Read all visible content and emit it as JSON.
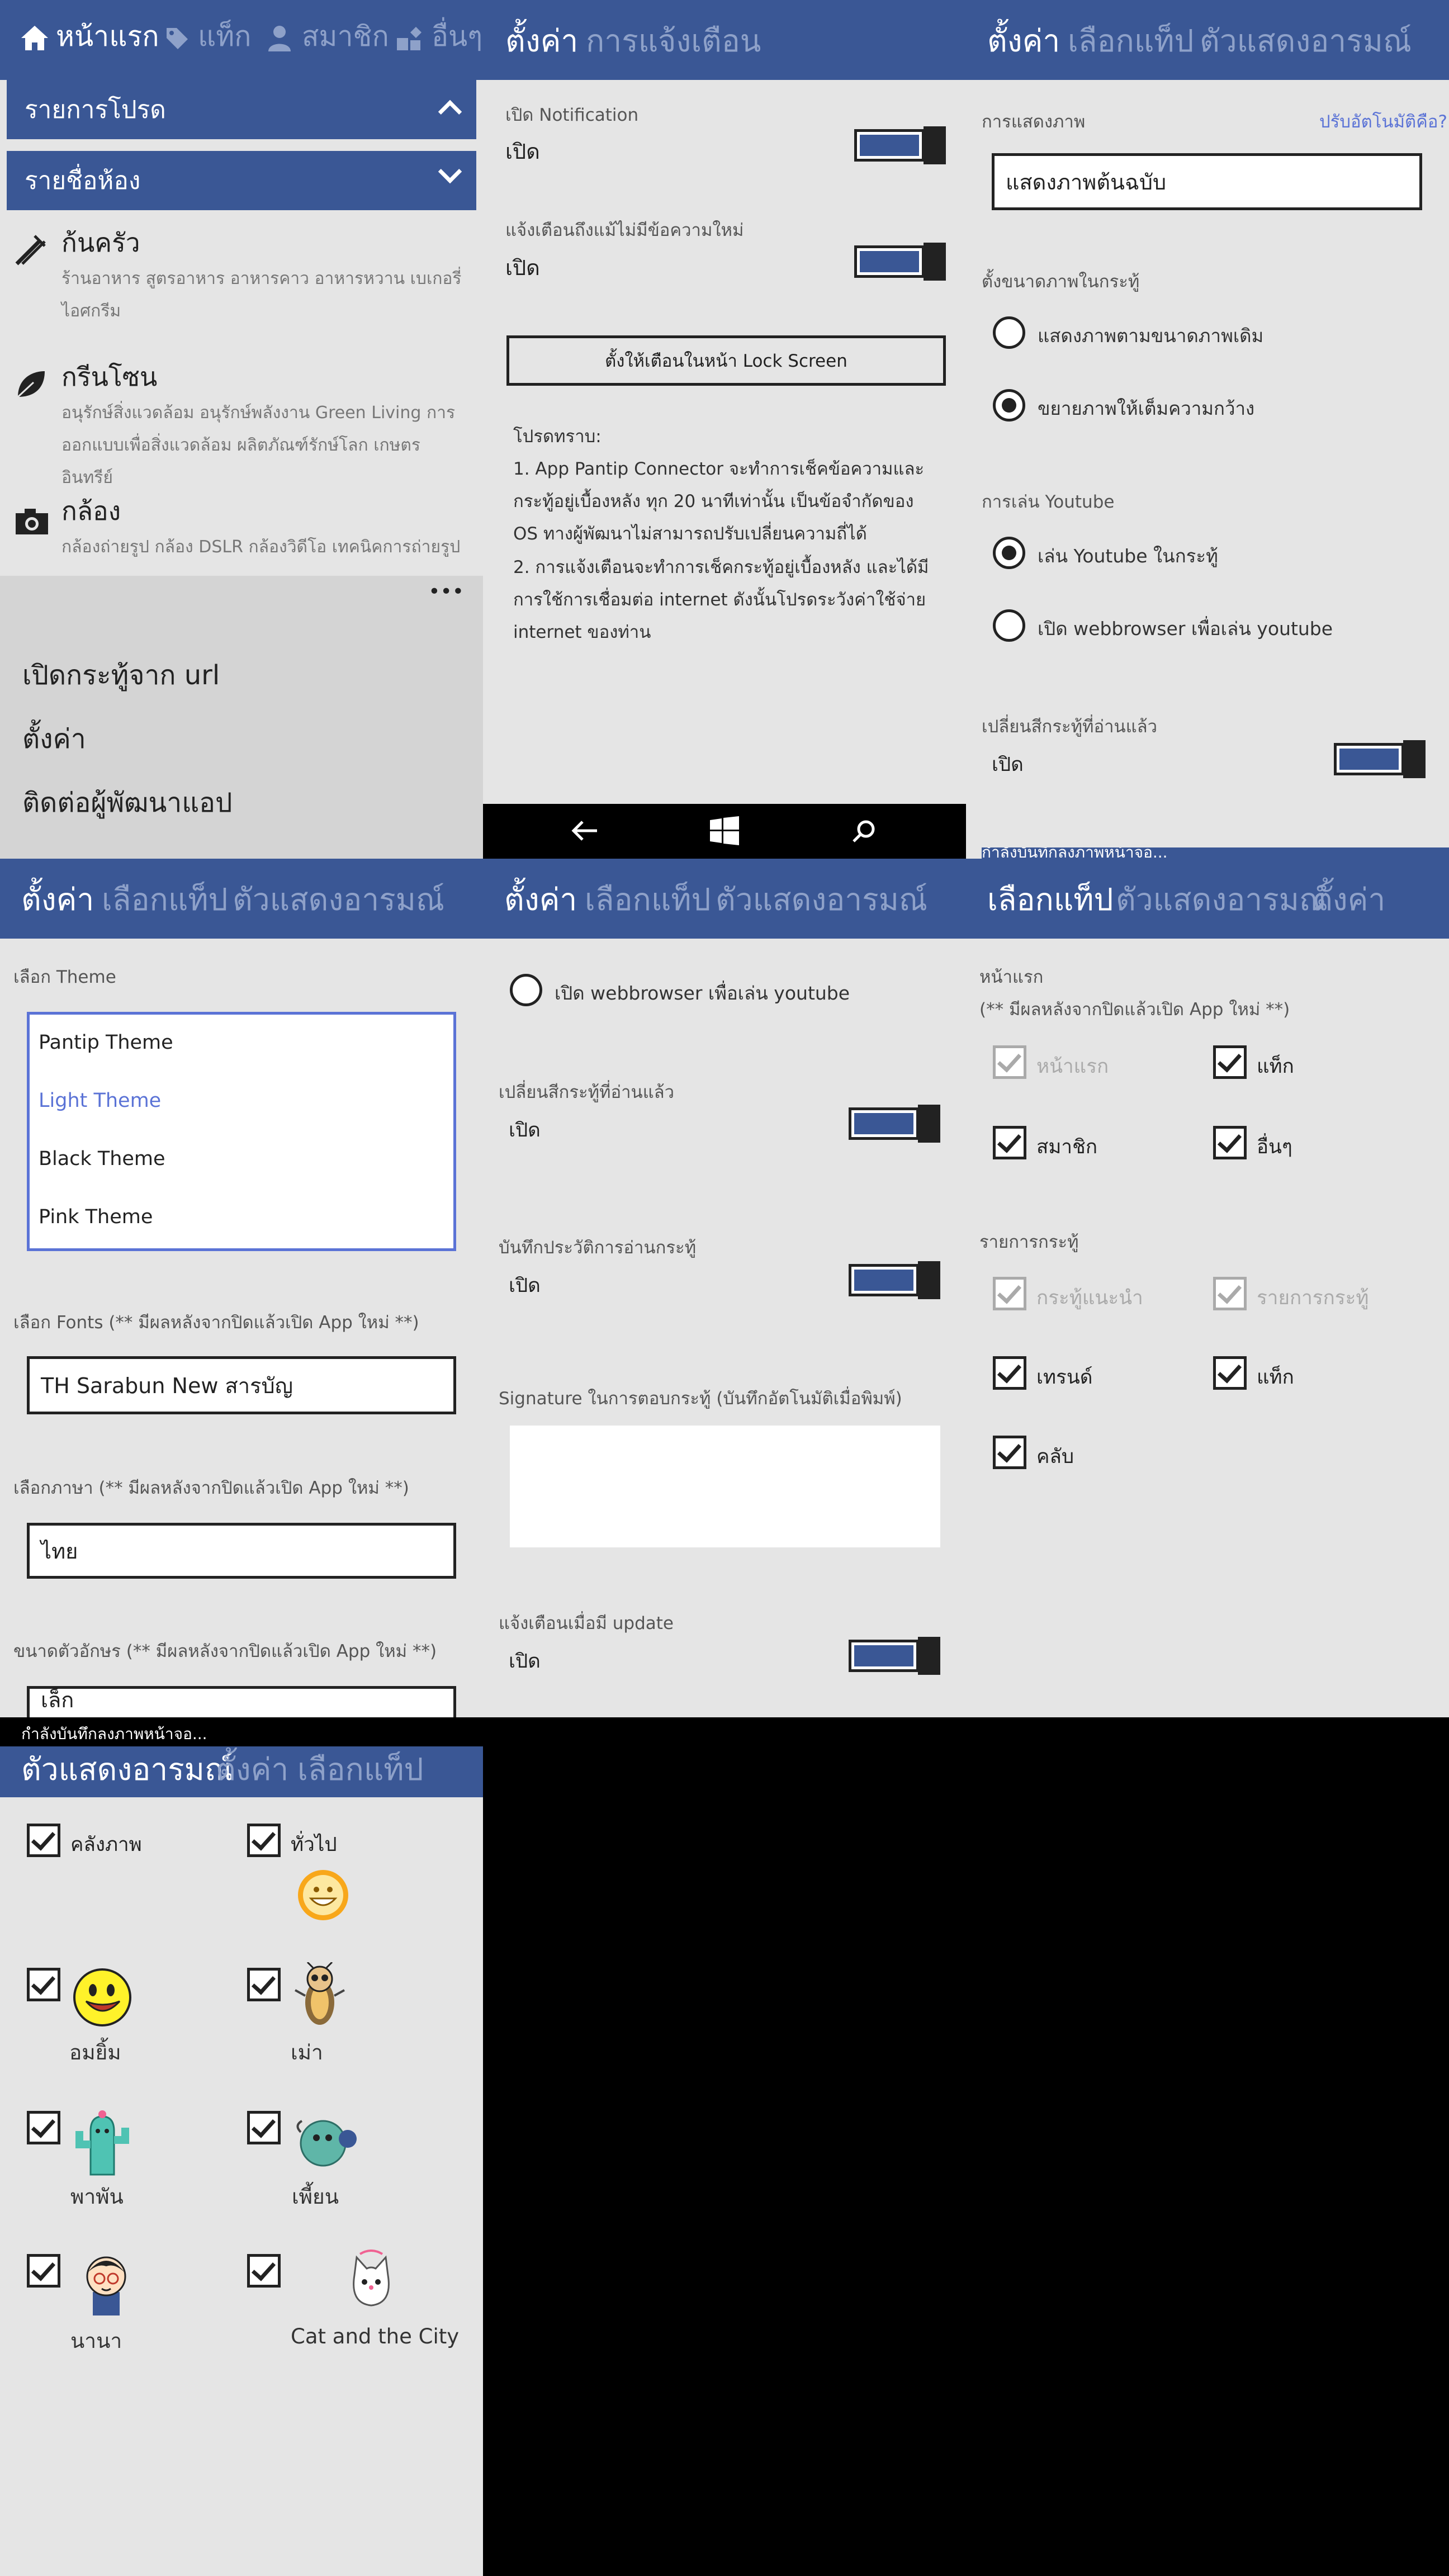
{
  "p1": {
    "tabs": [
      "หน้าแรก",
      "แท็ก",
      "สมาชิก",
      "อื่นๆ"
    ],
    "menu_fav": "รายการโปรด",
    "menu_rooms": "รายชื่อห้อง",
    "rooms": [
      {
        "title": "ก้นครัว",
        "desc": "ร้านอาหาร สูตรอาหาร อาหารคาว อาหารหวาน เบเกอรี่ ไอศกรีม"
      },
      {
        "title": "กรีนโซน",
        "desc": "อนุรักษ์สิ่งแวดล้อม อนุรักษ์พลังงาน Green Living การออกแบบเพื่อสิ่งแวดล้อม ผลิตภัณฑ์รักษ์โลก เกษตรอินทรีย์"
      },
      {
        "title": "กล้อง",
        "desc": "กล้องถ่ายรูป กล้อง DSLR กล้องวิดีโอ เทคนิคการถ่ายรูป"
      }
    ],
    "more": "•••",
    "open_url": "เปิดกระทู้จาก url",
    "settings": "ตั้งค่า",
    "contact": "ติดต่อผู้พัฒนาแอป"
  },
  "p2": {
    "tabs": [
      "ตั้งค่า",
      "การแจ้งเตือน"
    ],
    "notif_label": "เปิด Notification",
    "notif_val": "เปิด",
    "unread_label": "แจ้งเตือนถึงแม้ไม่มีข้อความใหม่",
    "unread_val": "เปิด",
    "lock_btn": "ตั้งให้เตือนในหน้า Lock Screen",
    "note_title": "โปรดทราบ:",
    "note_1": "1. App Pantip Connector จะทำการเช็คข้อความและกระทู้อยู่เบื้องหลัง ทุก 20 นาทีเท่านั้น เป็นข้อจำกัดของ OS ทางผู้พัฒนาไม่สามารถปรับเปลี่ยนความถี่ได้",
    "note_2": "2. การแจ้งเตือนจะทำการเช็คกระทู้อยู่เบื้องหลัง และได้มีการใช้การเชื่อมต่อ internet ดังนั้นโปรดระวังค่าใช้จ่าย internet ของท่าน"
  },
  "p3": {
    "tabs": [
      "ตั้งค่า",
      "เลือกแท็ป",
      "ตัวแสดงอารมณ์"
    ],
    "display_label": "การแสดงภาพ",
    "auto_link": "ปรับอัตโนมัติคือ?",
    "display_val": "แสดงภาพต้นฉบับ",
    "size_label": "ตั้งขนาดภาพในกระทู้",
    "size_opt1": "แสดงภาพตามขนาดภาพเดิม",
    "size_opt2": "ขยายภาพให้เต็มความกว้าง",
    "yt_label": "การเล่น Youtube",
    "yt_opt1": "เล่น Youtube ในกระทู้",
    "yt_opt2": "เปิด webbrowser เพื่อเล่น youtube",
    "read_label": "เปลี่ยนสีกระทู้ที่อ่านแล้ว",
    "read_val": "เปิด",
    "overflow_text": "กำลังบันทึกลงภาพหน้าจอ..."
  },
  "p4": {
    "tabs": [
      "ตั้งค่า",
      "เลือกแท็ป",
      "ตัวแสดงอารมณ์"
    ],
    "theme_label": "เลือก Theme",
    "themes": [
      "Pantip Theme",
      "Light Theme",
      "Black Theme",
      "Pink Theme"
    ],
    "font_label": "เลือก Fonts (** มีผลหลังจากปิดแล้วเปิด App ใหม่ **)",
    "font_val": "TH Sarabun New สารบัญ",
    "lang_label": "เลือกภาษา (** มีผลหลังจากปิดแล้วเปิด App ใหม่ **)",
    "lang_val": "ไทย",
    "size_label": "ขนาดตัวอักษร (** มีผลหลังจากปิดแล้วเปิด App ใหม่ **)",
    "size_val": "เล็ก"
  },
  "p5": {
    "tabs": [
      "ตั้งค่า",
      "เลือกแท็ป",
      "ตัวแสดงอารมณ์"
    ],
    "yt_opt2": "เปิด webbrowser เพื่อเล่น youtube",
    "read_label": "เปลี่ยนสีกระทู้ที่อ่านแล้ว",
    "read_val": "เปิด",
    "hist_label": "บันทึกประวัติการอ่านกระทู้",
    "hist_val": "เปิด",
    "sig_label": "Signature ในการตอบกระทู้ (บันทึกอัตโนมัติเมื่อพิมพ์)",
    "upd_label": "แจ้งเตือนเมื่อมี update",
    "upd_val": "เปิด"
  },
  "p6": {
    "tabs": [
      "เลือกแท็ป",
      "ตัวแสดงอารมณ์",
      "ตั้งค่า"
    ],
    "home_label": "หน้าแรก",
    "home_note": "(** มีผลหลังจากปิดแล้วเปิด App ใหม่ **)",
    "home_items": [
      "หน้าแรก",
      "แท็ก",
      "สมาชิก",
      "อื่นๆ"
    ],
    "list_label": "รายการกระทู้",
    "list_items": [
      "กระทู้แนะนำ",
      "รายการกระทู้",
      "เทรนด์",
      "แท็ก",
      "คลับ"
    ]
  },
  "p7": {
    "status": "กำลังบันทึกลงภาพหน้าจอ...",
    "tabs": [
      "ตัวแสดงอารมณ์",
      "ตั้งค่า",
      "เลือกแท็ป"
    ],
    "emos": [
      "คลังภาพ",
      "ทั่วไป",
      "อมยิ้ม",
      "เม่า",
      "พาพัน",
      "เพี้ยน",
      "นานา",
      "Cat and the City"
    ]
  },
  "colors": {
    "header": "#3a5795",
    "bg": "#e5e5e5",
    "accent": "#5b73d6"
  }
}
